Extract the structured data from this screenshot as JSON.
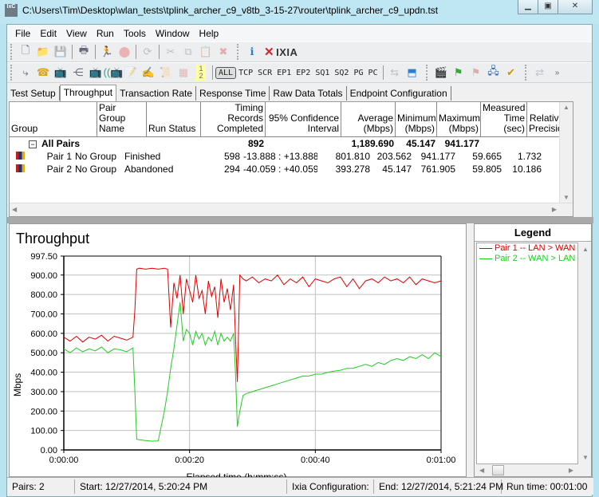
{
  "window": {
    "title": "C:\\Users\\Tim\\Desktop\\wlan_tests\\tplink_archer_c9_v8tb_3-15-27\\router\\tplink_archer_c9_updn.tst",
    "app_icon": "ixchariot-icon",
    "controls": [
      "minimize",
      "restore",
      "close"
    ]
  },
  "menu": [
    "File",
    "Edit",
    "View",
    "Run",
    "Tools",
    "Window",
    "Help"
  ],
  "toolbar1": {
    "icons": [
      "new-file-icon",
      "open-folder-icon",
      "save-icon",
      "print-icon",
      "run-icon",
      "stop-icon",
      "refresh-icon",
      "cut-icon",
      "copy-icon",
      "paste-icon",
      "delete-icon",
      "info-icon"
    ],
    "brand": "IXIA"
  },
  "toolbar2": {
    "icons": [
      "pair-icon",
      "phone-pair-icon",
      "endpoint-icon",
      "multicast-icon",
      "video-pair-icon",
      "voice-pair-icon",
      "edit-icon",
      "rename-icon",
      "script-icon",
      "group-icon",
      "pair-numbers-icon"
    ],
    "filters": [
      "ALL",
      "TCP",
      "SCR",
      "EP1",
      "EP2",
      "SQ1",
      "SQ2",
      "PG",
      "PC"
    ],
    "active_filter": "ALL",
    "icons_right": [
      "export-icon",
      "import-icon",
      "clapper-icon",
      "flag-green-icon",
      "flag-red-icon",
      "network-icon",
      "checklist-icon",
      "sync-icon"
    ]
  },
  "tabs": [
    "Test Setup",
    "Throughput",
    "Transaction Rate",
    "Response Time",
    "Raw Data Totals",
    "Endpoint Configuration"
  ],
  "active_tab": "Throughput",
  "grid": {
    "columns": [
      {
        "l1": "",
        "l2": "Group"
      },
      {
        "l1": "Pair Group",
        "l2": "Name"
      },
      {
        "l1": "",
        "l2": "Run Status"
      },
      {
        "l1": "Timing Records",
        "l2": "Completed"
      },
      {
        "l1": "95% Confidence",
        "l2": "Interval"
      },
      {
        "l1": "Average",
        "l2": "(Mbps)"
      },
      {
        "l1": "Minimum",
        "l2": "(Mbps)"
      },
      {
        "l1": "Maximum",
        "l2": "(Mbps)"
      },
      {
        "l1": "Measured",
        "l2": "Time (sec)"
      },
      {
        "l1": "Relative",
        "l2": "Precision"
      }
    ],
    "summary": {
      "label": "All Pairs",
      "records": "892",
      "average": "1,189.690",
      "minimum": "45.147",
      "maximum": "941.177"
    },
    "rows": [
      {
        "pair": "Pair 1",
        "group": "No Group",
        "status": "Finished",
        "records": "598",
        "ci": "-13.888 : +13.888",
        "average": "801.810",
        "minimum": "203.562",
        "maximum": "941.177",
        "time": "59.665",
        "precision": "1.732"
      },
      {
        "pair": "Pair 2",
        "group": "No Group",
        "status": "Abandoned",
        "records": "294",
        "ci": "-40.059 : +40.059",
        "average": "393.278",
        "minimum": "45.147",
        "maximum": "761.905",
        "time": "59.805",
        "precision": "10.186"
      }
    ]
  },
  "legend": {
    "title": "Legend",
    "items": [
      {
        "label": "Pair 1 -- LAN > WAN",
        "color": "#e00000"
      },
      {
        "label": "Pair 2 -- WAN > LAN",
        "color": "#22cc22"
      }
    ]
  },
  "chart_data": {
    "type": "line",
    "title": "Throughput",
    "xlabel": "Elapsed time (h:mm:ss)",
    "ylabel": "Mbps",
    "xlim": [
      0,
      60
    ],
    "ylim": [
      0,
      997.5
    ],
    "yticks": [
      "0.00",
      "100.00",
      "200.00",
      "300.00",
      "400.00",
      "500.00",
      "600.00",
      "700.00",
      "800.00",
      "900.00",
      "997.50"
    ],
    "xticks": [
      "0:00:00",
      "0:00:20",
      "0:00:40",
      "0:01:00"
    ],
    "grid": true,
    "series": [
      {
        "name": "Pair 1 -- LAN > WAN",
        "color": "#e00000",
        "x": [
          0,
          1,
          2,
          3,
          4,
          5,
          6,
          7,
          8,
          9,
          10,
          11,
          11.3,
          11.6,
          12,
          13,
          14,
          15,
          16,
          16.5,
          17,
          17.5,
          18,
          18.5,
          19,
          19.5,
          20,
          20.5,
          21,
          21.5,
          22,
          22.5,
          23,
          23.5,
          24,
          24.5,
          25,
          25.5,
          26,
          26.5,
          27,
          27.3,
          27.6,
          28,
          28.5,
          29,
          30,
          31,
          32,
          33,
          34,
          35,
          36,
          37,
          38,
          39,
          40,
          41,
          42,
          43,
          44,
          45,
          46,
          47,
          48,
          49,
          50,
          51,
          52,
          53,
          54,
          55,
          56,
          57,
          58,
          59,
          60
        ],
        "values": [
          580,
          560,
          585,
          555,
          580,
          570,
          590,
          560,
          585,
          575,
          565,
          580,
          720,
          930,
          935,
          930,
          935,
          930,
          935,
          930,
          630,
          860,
          780,
          900,
          700,
          880,
          820,
          760,
          900,
          780,
          820,
          700,
          870,
          790,
          840,
          680,
          880,
          760,
          830,
          720,
          850,
          580,
          350,
          900,
          880,
          870,
          890,
          860,
          880,
          870,
          900,
          850,
          880,
          860,
          890,
          840,
          880,
          870,
          860,
          880,
          890,
          840,
          880,
          830,
          870,
          880,
          860,
          890,
          870,
          880,
          860,
          890,
          850,
          880,
          870,
          860,
          870
        ]
      },
      {
        "name": "Pair 2 -- WAN > LAN",
        "color": "#22cc22",
        "x": [
          0,
          1,
          2,
          3,
          4,
          5,
          6,
          7,
          8,
          9,
          10,
          11,
          11.3,
          11.6,
          12,
          13,
          14,
          15,
          16,
          16.5,
          17,
          17.5,
          18,
          18.5,
          19,
          19.5,
          20,
          20.5,
          21,
          21.5,
          22,
          22.5,
          23,
          23.5,
          24,
          24.5,
          25,
          25.5,
          26,
          26.5,
          27,
          27.3,
          27.6,
          28,
          28.5,
          29,
          30,
          31,
          32,
          33,
          34,
          35,
          36,
          37,
          38,
          39,
          40,
          41,
          42,
          43,
          44,
          45,
          46,
          47,
          48,
          49,
          50,
          51,
          52,
          53,
          54,
          55,
          56,
          57,
          58,
          59,
          60
        ],
        "values": [
          520,
          500,
          525,
          505,
          520,
          510,
          530,
          500,
          520,
          515,
          505,
          525,
          300,
          55,
          52,
          48,
          45,
          46,
          200,
          300,
          420,
          520,
          640,
          760,
          560,
          620,
          600,
          540,
          610,
          570,
          600,
          540,
          580,
          560,
          610,
          540,
          600,
          560,
          580,
          560,
          600,
          400,
          120,
          200,
          280,
          290,
          300,
          310,
          320,
          330,
          340,
          350,
          360,
          370,
          380,
          380,
          390,
          390,
          400,
          405,
          410,
          420,
          420,
          430,
          440,
          430,
          450,
          440,
          460,
          470,
          460,
          480,
          470,
          490,
          470,
          500,
          480
        ]
      }
    ]
  },
  "status": {
    "pairs": "Pairs: 2",
    "start": "Start: 12/27/2014, 5:20:24 PM",
    "config": "Ixia Configuration:",
    "end": "End: 12/27/2014, 5:21:24 PM",
    "runtime": "Run time: 00:01:00"
  }
}
